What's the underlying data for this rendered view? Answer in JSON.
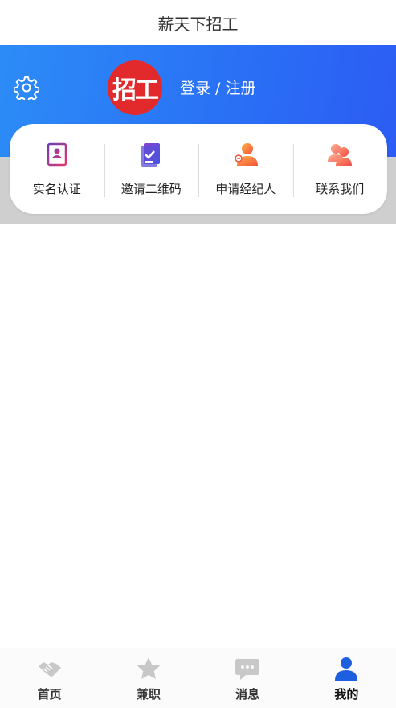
{
  "app": {
    "title": "薪天下招工"
  },
  "header": {
    "logo_text": "招工",
    "login_label": "登录 / 注册"
  },
  "quick_actions": [
    {
      "label": "实名认证",
      "icon": "id-card-icon"
    },
    {
      "label": "邀请二维码",
      "icon": "qr-document-icon"
    },
    {
      "label": "申请经纪人",
      "icon": "agent-person-icon"
    },
    {
      "label": "联系我们",
      "icon": "contact-people-icon"
    }
  ],
  "tabbar": {
    "items": [
      {
        "label": "首页",
        "icon": "handshake-icon"
      },
      {
        "label": "兼职",
        "icon": "star-icon"
      },
      {
        "label": "消息",
        "icon": "message-icon"
      },
      {
        "label": "我的",
        "icon": "person-icon"
      }
    ],
    "active_index": 3
  },
  "colors": {
    "header_blue": "#2a6ff5",
    "logo_red": "#e22a2c",
    "active_tab": "#1e5fe0",
    "inactive_tab": "#c8c8c8"
  }
}
